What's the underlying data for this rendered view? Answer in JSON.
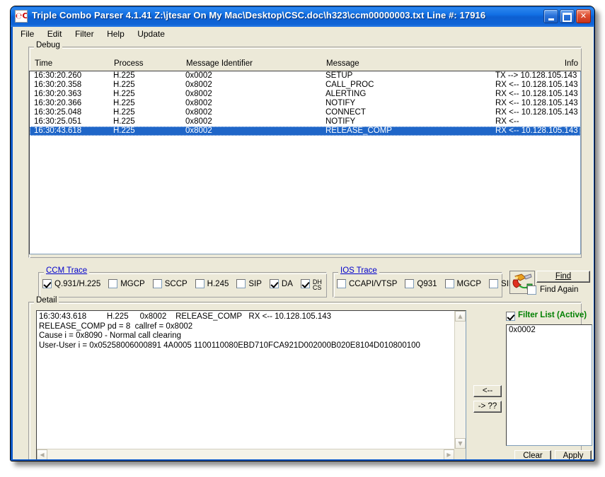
{
  "window": {
    "title": "Triple Combo Parser 4.1.41 Z:\\jtesar On My Mac\\Desktop\\CSC.doc\\h323\\ccm00000003.txt Line #: 17916",
    "icon": "app-icon",
    "minimize_label": "Minimize",
    "maximize_label": "Maximize",
    "close_label": "✕"
  },
  "menu": {
    "items": [
      {
        "label": "File"
      },
      {
        "label": "Edit"
      },
      {
        "label": "Filter"
      },
      {
        "label": "Help"
      },
      {
        "label": "Update"
      }
    ]
  },
  "debug": {
    "group_label": "Debug",
    "columns": {
      "time": "Time",
      "process": "Process",
      "message_identifier": "Message Identifier",
      "message": "Message",
      "info": "Info"
    },
    "rows": [
      {
        "time": "16:30:20.260",
        "process": "H.225",
        "msgid": "0x0002",
        "message": "SETUP",
        "info": "TX --> 10.128.105.143",
        "selected": false
      },
      {
        "time": "16:30:20.358",
        "process": "H.225",
        "msgid": "0x8002",
        "message": "CALL_PROC",
        "info": "RX <-- 10.128.105.143",
        "selected": false
      },
      {
        "time": "16:30:20.363",
        "process": "H.225",
        "msgid": "0x8002",
        "message": "ALERTING",
        "info": "RX <-- 10.128.105.143",
        "selected": false
      },
      {
        "time": "16:30:20.366",
        "process": "H.225",
        "msgid": "0x8002",
        "message": "NOTIFY",
        "info": "RX <-- 10.128.105.143",
        "selected": false
      },
      {
        "time": "16:30:25.048",
        "process": "H.225",
        "msgid": "0x8002",
        "message": "CONNECT",
        "info": "RX <-- 10.128.105.143",
        "selected": false
      },
      {
        "time": "16:30:25.051",
        "process": "H.225",
        "msgid": "0x8002",
        "message": "NOTIFY",
        "info": "RX <--",
        "selected": false
      },
      {
        "time": "16:30:43.618",
        "process": "H.225",
        "msgid": "0x8002",
        "message": "RELEASE_COMP",
        "info": "RX <-- 10.128.105.143",
        "selected": true
      }
    ]
  },
  "ccm_trace": {
    "group_label": "CCM Trace",
    "checkboxes": [
      {
        "label": "Q.931/H.225",
        "checked": true
      },
      {
        "label": "MGCP",
        "checked": false
      },
      {
        "label": "SCCP",
        "checked": false
      },
      {
        "label": "H.245",
        "checked": false
      },
      {
        "label": "SIP",
        "checked": false
      },
      {
        "label": "DA",
        "checked": true
      },
      {
        "label": "DHCS",
        "checked": true,
        "clipped": true
      }
    ]
  },
  "ios_trace": {
    "group_label": "IOS Trace",
    "checkboxes": [
      {
        "label": "CCAPI/VTSP",
        "checked": false
      },
      {
        "label": "Q931",
        "checked": false
      },
      {
        "label": "MGCP",
        "checked": false
      },
      {
        "label": "SIP",
        "checked": false
      }
    ]
  },
  "find": {
    "icon": "plug-connector-icon",
    "find_label": "Find",
    "find_accel": "F",
    "find_again_label": "Find Again",
    "find_again_checked": false
  },
  "detail": {
    "group_label": "Detail",
    "text": "16:30:43.618         H.225     0x8002    RELEASE_COMP   RX <-- 10.128.105.143\nRELEASE_COMP pd = 8  callref = 0x8002\nCause i = 0x8090 - Normal call clearing\nUser-User i = 0x05258006000891 4A0005 1100110080EBD710FCA921D002000B020E8104D010800100"
  },
  "filter": {
    "checkbox_label": "Filter List (Active)",
    "checkbox_checked": true,
    "label_color": "#008000",
    "items": [
      "0x0002"
    ],
    "move_left_label": "<--",
    "move_right_label": "-> ??",
    "clear_label": "Clear",
    "apply_label": "Apply"
  },
  "scroll": {
    "up_arrow": "▲",
    "down_arrow": "▼",
    "left_arrow": "◀",
    "right_arrow": "▶"
  },
  "colors": {
    "title_bar": "#0c58c6",
    "client_bg": "#ece9d8",
    "selection": "#1f66c8",
    "group_link": "#0000cc",
    "filter_active": "#008000"
  }
}
